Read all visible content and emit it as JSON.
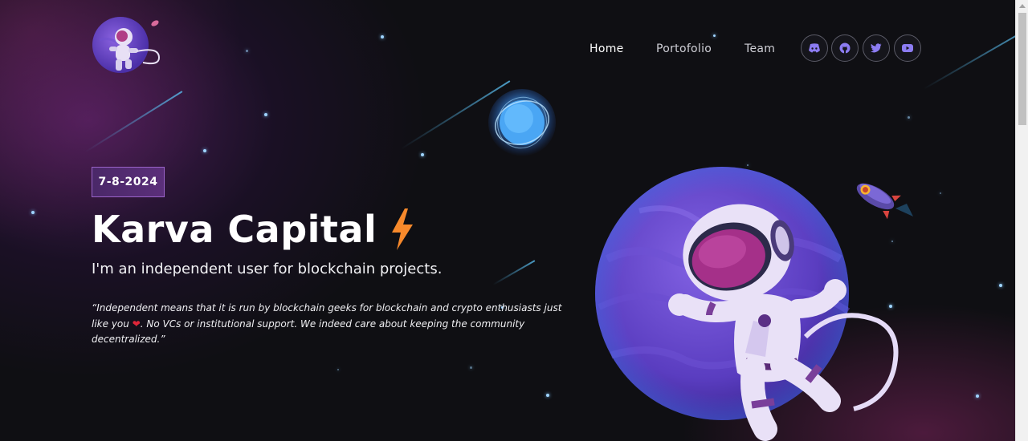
{
  "nav": {
    "home_label": "Home",
    "portfolio_label": "Portofolio",
    "team_label": "Team",
    "social": [
      {
        "icon": "discord-icon"
      },
      {
        "icon": "github-icon"
      },
      {
        "icon": "twitter-icon"
      },
      {
        "icon": "youtube-icon"
      }
    ]
  },
  "hero": {
    "date": "7-8-2024",
    "title": "Karva Capital",
    "subtitle": "I'm an independent user for blockchain projects.",
    "quote_part1": "“Independent means that it is run by blockchain geeks for blockchain and crypto enthusiasts just like you ",
    "quote_heart": "❤",
    "quote_part2": ". No VCs or institutional support. We indeed care about keeping the community decentralized.”"
  },
  "colors": {
    "accent_purple": "#5b2f7a",
    "badge_border": "#9a63c9",
    "bolt_orange": "#f7892b",
    "planet_purple": "#6a45c9",
    "heart_red": "#e02639"
  }
}
